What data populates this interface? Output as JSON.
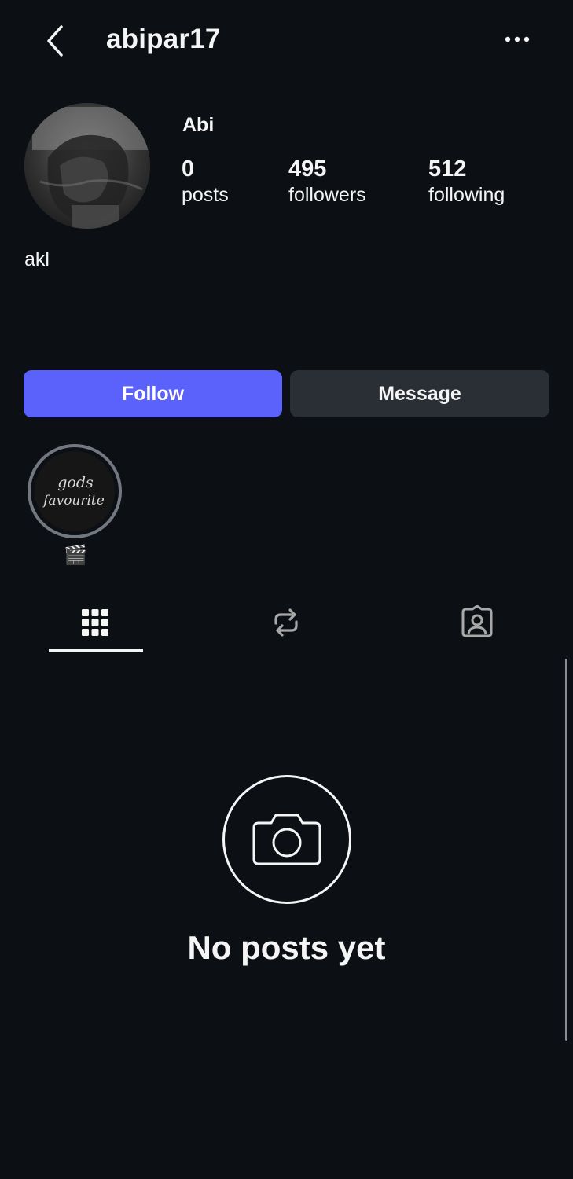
{
  "header": {
    "username": "abipar17",
    "back_icon": "chevron-left-icon",
    "more_icon": "more-horizontal-icon"
  },
  "profile": {
    "display_name": "Abi",
    "avatar_icon": "profile-photo",
    "bio": "akl",
    "stats": [
      {
        "value": "0",
        "label": "posts"
      },
      {
        "value": "495",
        "label": "followers"
      },
      {
        "value": "512",
        "label": "following"
      }
    ]
  },
  "actions": {
    "follow_label": "Follow",
    "message_label": "Message"
  },
  "highlights": [
    {
      "cover_text": "gods favourite",
      "label": "🎬"
    }
  ],
  "tabs": [
    {
      "icon": "grid-icon",
      "selected": true
    },
    {
      "icon": "repost-icon",
      "selected": false
    },
    {
      "icon": "tagged-person-icon",
      "selected": false
    }
  ],
  "empty_state": {
    "icon": "camera-icon",
    "text": "No posts yet"
  },
  "colors": {
    "background": "#0c1014",
    "follow_button": "#5b62fb",
    "message_button": "#2a2f36",
    "text": "#f5f5f5"
  }
}
